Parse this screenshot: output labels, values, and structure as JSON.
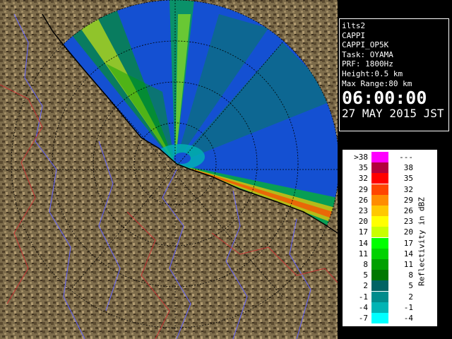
{
  "info": {
    "radar_name": "ilts2",
    "product": "CAPPI",
    "product_code": "CAPPI_OP5K",
    "task": "Task: OYAMA",
    "prf": "PRF: 1800Hz",
    "height": "Height:0.5 km",
    "max_range": "Max Range:80 km",
    "time": "06:00:00",
    "date": "27 MAY 2015 JST"
  },
  "legend": {
    "title": "Reflectivity in dBZ",
    "rows": [
      {
        "low": ">38",
        "high": "---",
        "color": "#ff00ff"
      },
      {
        "low": "35",
        "high": "38",
        "color": "#b4003c"
      },
      {
        "low": "32",
        "high": "35",
        "color": "#ff0000"
      },
      {
        "low": "29",
        "high": "32",
        "color": "#ff4500"
      },
      {
        "low": "26",
        "high": "29",
        "color": "#ff8c00"
      },
      {
        "low": "23",
        "high": "26",
        "color": "#ffc800"
      },
      {
        "low": "20",
        "high": "23",
        "color": "#ffff00"
      },
      {
        "low": "17",
        "high": "20",
        "color": "#c8ff00"
      },
      {
        "low": "14",
        "high": "17",
        "color": "#00ff00"
      },
      {
        "low": "11",
        "high": "14",
        "color": "#00d200"
      },
      {
        "low": "8",
        "high": "11",
        "color": "#00a000"
      },
      {
        "low": "5",
        "high": "8",
        "color": "#007800"
      },
      {
        "low": "2",
        "high": "5",
        "color": "#006464"
      },
      {
        "low": "-1",
        "high": "2",
        "color": "#008c8c"
      },
      {
        "low": "-4",
        "high": "-1",
        "color": "#00b4b4"
      },
      {
        "low": "-7",
        "high": "-4",
        "color": "#00ffff"
      }
    ]
  },
  "colors": {
    "background": "#000000",
    "ocean_coverage": "#1450d2",
    "terrain": "#7a6a4a",
    "rivers": "#6464ff",
    "boundaries": "#c83232",
    "coastline": "#000000",
    "range_rings": "#000000"
  }
}
